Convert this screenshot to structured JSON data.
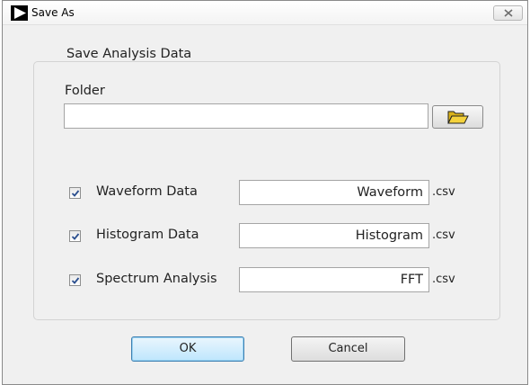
{
  "window": {
    "title": "Save As"
  },
  "group": {
    "title": "Save Analysis Data"
  },
  "folder": {
    "label": "Folder",
    "value": ""
  },
  "rows": [
    {
      "label": "Waveform Data",
      "checked": true,
      "filename": "Waveform",
      "extension": ".csv"
    },
    {
      "label": "Histogram Data",
      "checked": true,
      "filename": "Histogram",
      "extension": ".csv"
    },
    {
      "label": "Spectrum Analysis",
      "checked": true,
      "filename": "FFT",
      "extension": ".csv"
    }
  ],
  "buttons": {
    "ok": "OK",
    "cancel": "Cancel"
  },
  "icons": {
    "app": "play-arrow-icon",
    "close": "close-icon",
    "browse": "folder-open-icon",
    "check": "checkmark-icon"
  },
  "colors": {
    "window_bg": "#f0f0f0",
    "ok_border": "#3c7fb1",
    "folder_icon": "#e8c21a",
    "check": "#2b4f8f"
  }
}
